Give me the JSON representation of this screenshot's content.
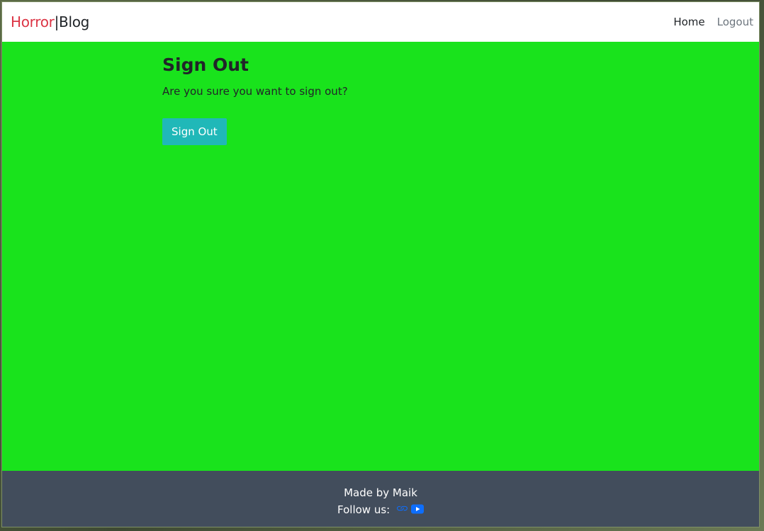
{
  "navbar": {
    "brand_part1": "Horror",
    "brand_separator": "|",
    "brand_part2": "Blog",
    "links": [
      {
        "label": "Home",
        "state": "active"
      },
      {
        "label": "Logout",
        "state": "muted"
      }
    ]
  },
  "main": {
    "title": "Sign Out",
    "message": "Are you sure you want to sign out?",
    "button_label": "Sign Out"
  },
  "footer": {
    "credit": "Made by Maik",
    "follow_label": "Follow us:",
    "icons": [
      "link-icon",
      "youtube-icon"
    ]
  },
  "colors": {
    "page_background": "#19e31c",
    "brand_accent": "#dc3545",
    "button": "#20b8b8",
    "footer": "#424d5c",
    "icon": "#0d6efd"
  }
}
